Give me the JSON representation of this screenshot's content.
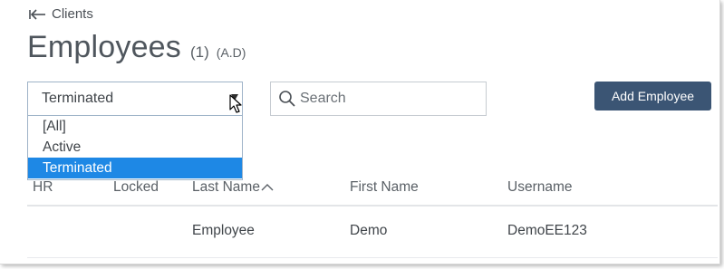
{
  "breadcrumb": {
    "back_label": "Clients"
  },
  "header": {
    "title": "Employees",
    "count": "(1)",
    "suffix": "(A.D)"
  },
  "status_filter": {
    "selected": "Terminated",
    "options": [
      "[All]",
      "Active",
      "Terminated"
    ]
  },
  "search": {
    "placeholder": "Search",
    "value": ""
  },
  "toolbar": {
    "add_employee_label": "Add Employee"
  },
  "table": {
    "columns": [
      "HR",
      "Locked",
      "Last Name",
      "First Name",
      "Username"
    ],
    "sorted_column": "Last Name",
    "sort_direction": "ascending",
    "rows": [
      {
        "hr": "",
        "locked": "",
        "last_name": "Employee",
        "first_name": "Demo",
        "username": "DemoEE123"
      }
    ]
  },
  "colors": {
    "accent": "#1e88e5",
    "button": "#3b5574",
    "select_border": "#9eb3c8"
  },
  "icons": {
    "back": "arrow-left-icon",
    "search": "search-icon",
    "sort": "chevron-up-icon",
    "dropdown": "caret-down-icon"
  }
}
